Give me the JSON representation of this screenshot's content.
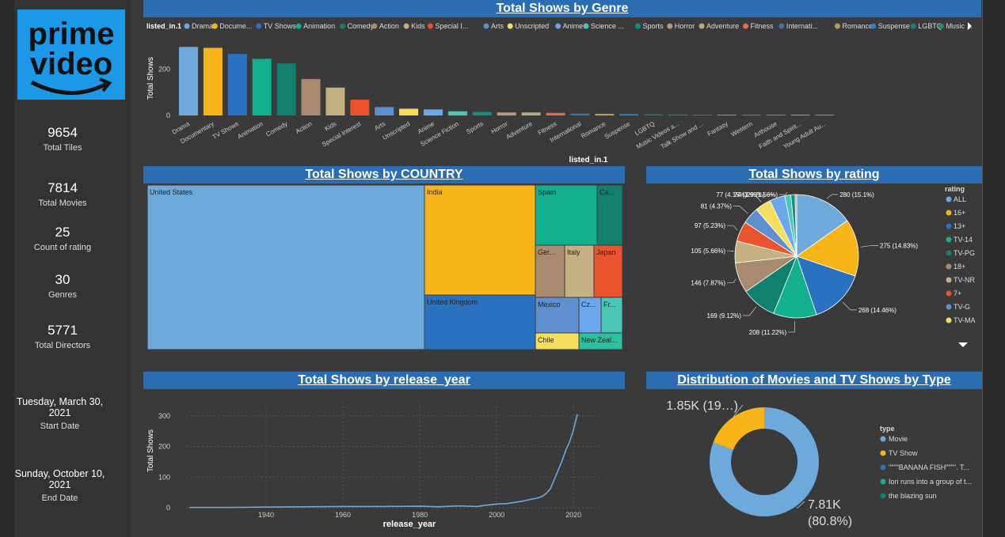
{
  "kpis": [
    {
      "value": "9654",
      "label": "Total Tiles"
    },
    {
      "value": "7814",
      "label": "Total Movies"
    },
    {
      "value": "25",
      "label": "Count of rating"
    },
    {
      "value": "30",
      "label": "Genres"
    },
    {
      "value": "5771",
      "label": "Total Directors"
    }
  ],
  "dates": [
    {
      "value": "Tuesday, March 30, 2021",
      "label": "Start Date"
    },
    {
      "value": "Sunday, October 10, 2021",
      "label": "End Date"
    }
  ],
  "logo": {
    "line1": "prime",
    "line2": "video"
  },
  "titles": {
    "genre": "Total Shows by Genre",
    "country": "Total Shows by COUNTRY",
    "rating": "Total Shows by rating",
    "year": "Total Shows by release_year",
    "type": "Distribution of Movies and TV Shows by Type"
  },
  "colors": {
    "accent": "#2a6db3",
    "background": "#3a3a3a"
  },
  "chart_data": [
    {
      "id": "genre",
      "type": "bar",
      "title": "Total Shows by Genre",
      "xlabel": "listed_in.1",
      "ylabel": "Total Shows",
      "legend_title": "listed_in.1",
      "legend_items": [
        "Drama",
        "Docume...",
        "TV Shows",
        "Animation",
        "Comedy",
        "Action",
        "Kids",
        "Special I...",
        "Arts",
        "Unscripted",
        "Anime",
        "Science ...",
        "Sports",
        "Horror",
        "Adventure",
        "Fitness",
        "Internati...",
        "Romance",
        "Suspense",
        "LGBTQ",
        "Music ..."
      ],
      "categories": [
        "Drama",
        "Documentary",
        "TV Shows",
        "Animation",
        "Comedy",
        "Action",
        "Kids",
        "Special Interest",
        "Arts",
        "Unscripted",
        "Anime",
        "Science Fiction",
        "Sports",
        "Horror",
        "Adventure",
        "Fitness",
        "International",
        "Romance",
        "Suspense",
        "LGBTQ",
        "Music Videos a...",
        "Talk Show and ...",
        "Fantasy",
        "Western",
        "Arthouse",
        "Faith and Spirit...",
        "Young Adult Au..."
      ],
      "values": [
        295,
        291,
        265,
        244,
        224,
        157,
        120,
        68,
        36,
        29,
        26,
        18,
        15,
        13,
        13,
        11,
        8,
        7,
        6,
        5,
        4,
        3,
        2,
        2,
        1,
        1,
        1
      ],
      "colors": [
        "#6ea9dc",
        "#f7b51a",
        "#2a72bf",
        "#12b08e",
        "#12806e",
        "#a88b6f",
        "#c4b082",
        "#e9532e",
        "#5e90d0",
        "#f5de5e",
        "#6ca7eb",
        "#49c6b6",
        "#148e80",
        "#b49a80",
        "#b8aa7a",
        "#e56a50",
        "#3f72a8",
        "#b89a62",
        "#2f80cc",
        "#14807a",
        "#1f8a77",
        "#7a6655",
        "#a59362",
        "#c06040",
        "#6d8fb0",
        "#b09a70",
        "#a08a72"
      ],
      "yticks": [
        0,
        200
      ],
      "ylim": [
        0,
        320
      ]
    },
    {
      "id": "country",
      "type": "treemap",
      "title": "Total Shows by COUNTRY",
      "labels": [
        "United States",
        "India",
        "United Kingdom",
        "Spain",
        "Ca...",
        "Ger...",
        "Italy",
        "Japan",
        "Mexico",
        "Cz...",
        "Fr...",
        "Chile",
        "New Zeal..."
      ]
    },
    {
      "id": "rating",
      "type": "pie",
      "title": "Total Shows by rating",
      "legend_title": "rating",
      "slices": [
        {
          "name": "ALL",
          "value": 280,
          "label": "280 (15.1%)",
          "color": "#6ea9dc"
        },
        {
          "name": "16+",
          "value": 275,
          "label": "275 (14.83%)",
          "color": "#f7b51a"
        },
        {
          "name": "13+",
          "value": 268,
          "label": "268 (14.46%)",
          "color": "#2a72bf"
        },
        {
          "name": "TV-14",
          "value": 208,
          "label": "208 (11.22%)",
          "color": "#12b08e"
        },
        {
          "name": "TV-PG",
          "value": 169,
          "label": "169 (9.12%)",
          "color": "#12806e"
        },
        {
          "name": "18+",
          "value": 146,
          "label": "146 (7.87%)",
          "color": "#a88b6f"
        },
        {
          "name": "TV-NR",
          "value": 105,
          "label": "105 (5.66%)",
          "color": "#c4b082"
        },
        {
          "name": "7+",
          "value": 97,
          "label": "97 (5.23%)",
          "color": "#e9532e"
        },
        {
          "name": "TV-G",
          "value": 81,
          "label": "81 (4.37%)",
          "color": "#5e90d0"
        },
        {
          "name": "TV-MA",
          "value": 77,
          "label": "77 (4.15%)",
          "color": "#f5de5e"
        },
        {
          "name": "",
          "value": 74,
          "label": "74 (3.99%)",
          "color": "#6ca7eb"
        },
        {
          "name": "",
          "value": 29,
          "label": "29 (1.56%)",
          "color": "#49c6b6"
        },
        {
          "name": "",
          "value": 20,
          "label": "",
          "color": "#148e80"
        },
        {
          "name": "",
          "value": 8,
          "label": "",
          "color": "#b49a80"
        }
      ]
    },
    {
      "id": "year",
      "type": "line",
      "title": "Total Shows by release_year",
      "xlabel": "release_year",
      "ylabel": "Total Shows",
      "xlim": [
        1920,
        2021
      ],
      "ylim": [
        0,
        320
      ],
      "xticks": [
        1940,
        1960,
        1980,
        2000,
        2020
      ],
      "yticks": [
        0,
        100,
        200,
        300
      ],
      "x": [
        1920,
        1930,
        1940,
        1950,
        1960,
        1970,
        1980,
        1985,
        1990,
        1995,
        1997,
        2000,
        2003,
        2005,
        2007,
        2009,
        2010,
        2011,
        2012,
        2013,
        2014,
        2015,
        2016,
        2017,
        2018,
        2019,
        2020,
        2021
      ],
      "y": [
        1,
        1,
        2,
        3,
        4,
        4,
        5,
        3,
        6,
        4,
        8,
        12,
        14,
        18,
        22,
        28,
        30,
        33,
        38,
        48,
        62,
        92,
        122,
        152,
        188,
        215,
        255,
        305
      ],
      "color": "#6ea9dc"
    },
    {
      "id": "type",
      "type": "pie",
      "title": "Distribution of Movies and TV Shows by Type",
      "legend_title": "type",
      "legend_items": [
        {
          "name": "Movie",
          "color": "#6ea9dc"
        },
        {
          "name": "TV Show",
          "color": "#f7b51a"
        },
        {
          "name": "\"\"\"\"BANANA FISH\"\"\"\". T...",
          "color": "#2a72bf"
        },
        {
          "name": "Iori runs into a group of t...",
          "color": "#12b08e"
        },
        {
          "name": "the blazing sun",
          "color": "#12806e"
        }
      ],
      "slices": [
        {
          "name": "Movie",
          "value": 7810,
          "label1": "7.81K",
          "label2": "(80.8%)",
          "color": "#6ea9dc"
        },
        {
          "name": "TV Show",
          "value": 1850,
          "label1": "1.85K (19…)",
          "label2": "",
          "color": "#f7b51a"
        }
      ]
    }
  ]
}
